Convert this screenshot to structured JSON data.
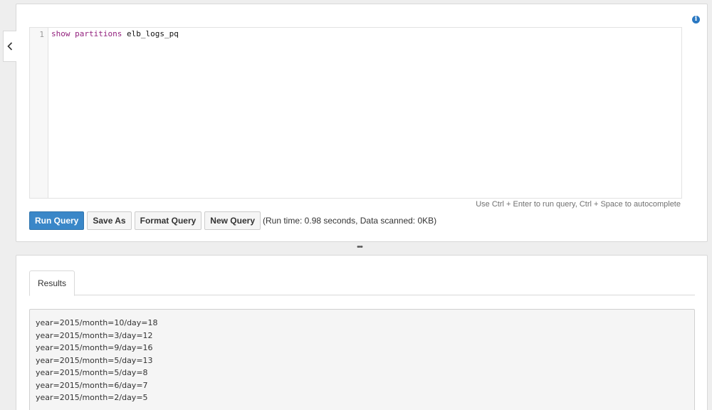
{
  "editor": {
    "line_number": "1",
    "code": {
      "keyword_1": "show",
      "keyword_2": "partitions",
      "table_name": "elb_logs_pq"
    },
    "hint": "Use Ctrl + Enter to run query, Ctrl + Space to autocomplete"
  },
  "toolbar": {
    "run_query": "Run Query",
    "save_as": "Save As",
    "format_query": "Format Query",
    "new_query": "New Query",
    "status": "(Run time: 0.98 seconds, Data scanned: 0KB)"
  },
  "icons": {
    "collapse": "chevron-left-icon",
    "info": "info-icon",
    "resizer": "drag-handle-icon"
  },
  "info_glyph": "i",
  "resizer_glyph": "•••",
  "results": {
    "tab_label": "Results",
    "rows": [
      "year=2015/month=10/day=18",
      "year=2015/month=3/day=12",
      "year=2015/month=9/day=16",
      "year=2015/month=5/day=13",
      "year=2015/month=5/day=8",
      "year=2015/month=6/day=7",
      "year=2015/month=2/day=5"
    ]
  },
  "colors": {
    "primary_button": "#3a87c8",
    "keyword": "#93217e",
    "info_icon": "#2a78c2"
  }
}
